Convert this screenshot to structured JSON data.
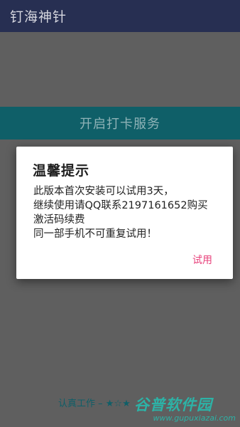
{
  "app_bar": {
    "title": "钉海神针"
  },
  "main": {
    "service_button_label": "开启打卡服务"
  },
  "footer": {
    "text": "认真工作 –",
    "stars": "★☆★"
  },
  "dialog": {
    "title": "温馨提示",
    "message_lines": [
      "此版本首次安装可以试用3天，",
      "继续使用请QQ联系2197161652购买",
      "激活码续费",
      "同一部手机不可重复试用！"
    ],
    "action_label": "试用"
  },
  "watermark": {
    "logo_text": "谷普软件园",
    "url": "www.gupuxiazai.com"
  },
  "colors": {
    "app_bar": "#272f52",
    "accent_teal": "#0f5f68",
    "action_pink": "#e8417b",
    "watermark_teal": "#2db2a6"
  }
}
